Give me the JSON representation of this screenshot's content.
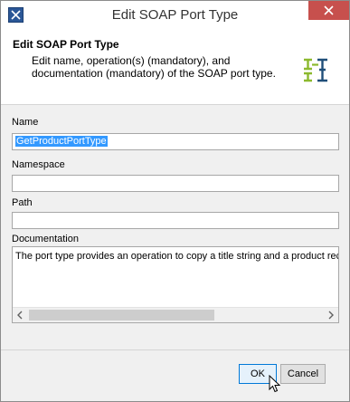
{
  "window": {
    "title": "Edit SOAP Port Type"
  },
  "header": {
    "title": "Edit SOAP Port Type",
    "description": "Edit name, operation(s) (mandatory), and documentation (mandatory) of the SOAP port type.",
    "logo_icon": "port-type-icon"
  },
  "form": {
    "name_label": "Name",
    "name_value": "GetProductPortType",
    "namespace_label": "Namespace",
    "namespace_value": "",
    "path_label": "Path",
    "path_value": "",
    "documentation_label": "Documentation",
    "documentation_value": "The port type provides an operation to copy a title string and a product rec"
  },
  "buttons": {
    "ok": "OK",
    "cancel": "Cancel"
  },
  "colors": {
    "close_button": "#c7504d",
    "selection": "#3399ff",
    "logo_green": "#8cb92e",
    "logo_blue": "#1f4e79"
  }
}
